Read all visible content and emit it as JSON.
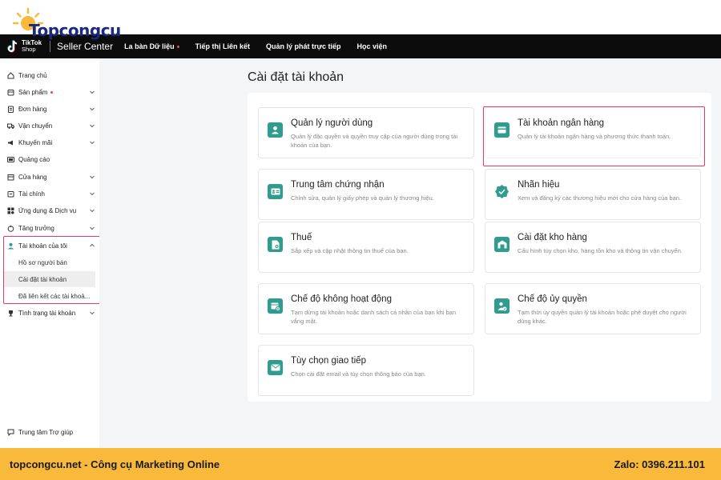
{
  "watermark": {
    "brand": "Topcongcu"
  },
  "topbar": {
    "logo_line1": "TikTok",
    "logo_line2": "Shop",
    "seller_center": "Seller Center",
    "nav": [
      {
        "label": "La bàn Dữ liệu",
        "dot": true
      },
      {
        "label": "Tiếp thị Liên kết",
        "dot": false
      },
      {
        "label": "Quản lý phát trực tiếp",
        "dot": false
      },
      {
        "label": "Học viện",
        "dot": false
      }
    ]
  },
  "sidebar": {
    "items": [
      {
        "label": "Trang chủ",
        "icon": "home-icon"
      },
      {
        "label": "Sản phẩm",
        "icon": "product-icon"
      },
      {
        "label": "Đơn hàng",
        "icon": "order-icon"
      },
      {
        "label": "Vận chuyển",
        "icon": "truck-icon"
      },
      {
        "label": "Khuyến mãi",
        "icon": "megaphone-icon"
      },
      {
        "label": "Quảng cáo",
        "icon": "ad-icon"
      },
      {
        "label": "Cửa hàng",
        "icon": "store-icon"
      },
      {
        "label": "Tài chính",
        "icon": "wallet-icon"
      },
      {
        "label": "Ứng dụng & Dịch vụ",
        "icon": "apps-icon"
      },
      {
        "label": "Tăng trưởng",
        "icon": "growth-icon"
      },
      {
        "label": "Tài khoản của tôi",
        "icon": "user-icon"
      },
      {
        "label": "Tình trạng tài khoản",
        "icon": "trophy-icon"
      }
    ],
    "subitems": [
      {
        "label": "Hồ sơ người bán"
      },
      {
        "label": "Cài đặt tài khoản"
      },
      {
        "label": "Đã liên kết các tài khoả..."
      }
    ],
    "help": "Trung tâm Trợ giúp"
  },
  "main": {
    "title": "Cài đặt tài khoản",
    "cards": [
      {
        "title": "Quản lý người dùng",
        "desc": "Quản lý đặc quyền và quyền truy cập của người dùng trong tài khoản của bạn.",
        "icon": "user-icon"
      },
      {
        "title": "Tài khoản ngân hàng",
        "desc": "Quản lý tài khoản ngân hàng và phương thức thanh toán.",
        "icon": "card-icon"
      },
      {
        "title": "Trung tâm chứng nhận",
        "desc": "Chỉnh sửa, quản lý giấy phép và quản lý thương hiệu.",
        "icon": "id-card-icon"
      },
      {
        "title": "Nhãn hiệu",
        "desc": "Xem và đăng ký các thương hiệu mới cho cửa hàng của bạn.",
        "icon": "badge-check-icon"
      },
      {
        "title": "Thuế",
        "desc": "Sắp xếp và cập nhật thông tin thuế của bạn.",
        "icon": "tax-doc-icon"
      },
      {
        "title": "Cài đặt kho hàng",
        "desc": "Cấu hình tùy chọn kho, hàng tồn kho và thông tin vận chuyển.",
        "icon": "warehouse-icon"
      },
      {
        "title": "Chế độ không hoạt động",
        "desc": "Tạm dừng tài khoản hoặc danh sách cá nhân của bạn khi bạn vắng mặt.",
        "icon": "calendar-pause-icon"
      },
      {
        "title": "Chế độ ủy quyền",
        "desc": "Tạm thời ủy quyền quản lý tài khoản hoặc phê duyệt cho người dùng khác.",
        "icon": "user-delegate-icon"
      },
      {
        "title": "Tùy chọn giao tiếp",
        "desc": "Chọn cài đặt email và tùy chọn thông báo của bạn.",
        "icon": "mail-icon"
      }
    ]
  },
  "footer": {
    "left": "topcongcu.net - Công cụ Marketing Online",
    "right": "Zalo: 0396.211.101"
  },
  "colors": {
    "accent": "#2f9c8f",
    "highlight": "#e5396b",
    "banner": "#f9b93b",
    "topbar": "#0c0c0c"
  }
}
